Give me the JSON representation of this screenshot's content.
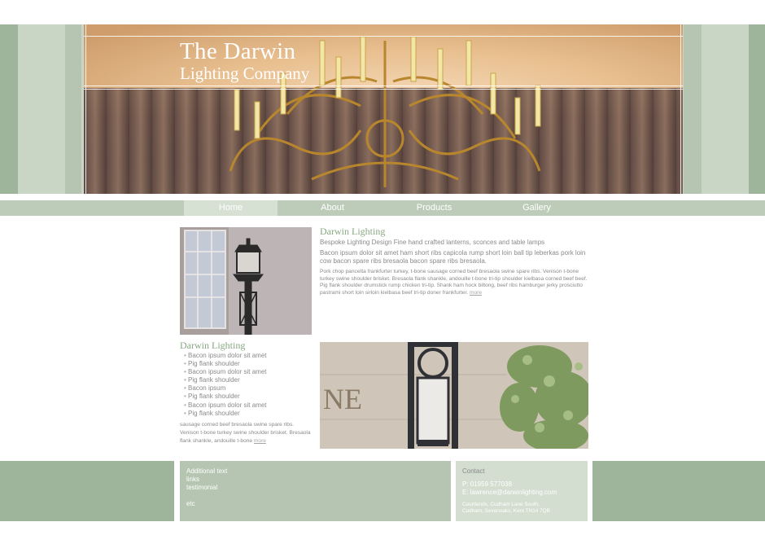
{
  "header": {
    "logo_line1": "The Darwin",
    "logo_line2": "Lighting Company"
  },
  "nav": {
    "items": [
      {
        "label": "Home",
        "active": true
      },
      {
        "label": "About",
        "active": false
      },
      {
        "label": "Products",
        "active": false
      },
      {
        "label": "Gallery",
        "active": false
      }
    ]
  },
  "main": {
    "section1": {
      "title": "Darwin Lighting",
      "subtitle": "Bespoke Lighting Design Fine hand crafted lanterns, sconces and table lamps",
      "para1": "Bacon ipsum dolor sit amet ham short ribs capicola rump short loin ball tip leberkas pork loin cow bacon spare ribs bresaola bacon spare ribs bresaola.",
      "para2": "Pork chop pancetta frankfurter turkey, t-bone sausage corned beef bresaola swine spare ribs. Venison t-bone turkey swine shoulder brisket. Bresaola flank shankle, andouille t-bone tri-tip shoulder kielbasa corned beef beef. Pig flank shoulder drumstick rump chicken tri-tip. Shank ham hock biltong, beef ribs hamburger jerky prosciutto pastrami short loin sirloin kielbasa beef tri-tip doner frankfurter.",
      "more": "more"
    },
    "section2": {
      "title": "Darwin Lighting",
      "list": [
        "Bacon ipsum dolor sit amet",
        "Pig flank shoulder",
        "Bacon ipsum dolor sit amet",
        "Pig flank shoulder",
        "Bacon ipsum",
        "Pig flank shoulder",
        "Bacon ipsum dolor sit amet",
        "Pig flank shoulder"
      ],
      "para": "sausage corned beef bresaola swine spare ribs. Venison t-bone turkey swine shoulder brisket. Bresaola flank shankle, andouille t-bone",
      "more": "more"
    },
    "photo2_sign_text": "NE"
  },
  "footer": {
    "lines": [
      "Additional text",
      "links",
      "testimonial",
      "",
      "etc"
    ],
    "contact": {
      "heading": "Contact",
      "phone": "P: 01959 577038",
      "email": "E: lawrence@darwinlighting.com",
      "address1": "Courtlands, Cudham Lane South,",
      "address2": "Cudham, Sevenoaks, Kent TN14 7QB"
    }
  },
  "colors": {
    "sage_dark": "#9fb59b",
    "sage_mid": "#b5c5b1",
    "sage_light": "#c9d5c5",
    "heading_green": "#88a882",
    "text_grey": "#8a8a8a"
  }
}
